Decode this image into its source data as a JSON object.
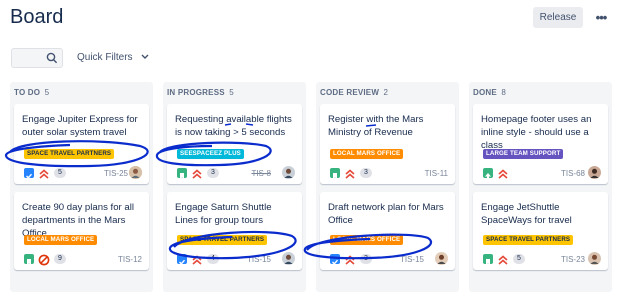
{
  "page": {
    "title": "Board"
  },
  "toolbar": {
    "release_label": "Release",
    "more_label": "•••"
  },
  "filters": {
    "search_value": "",
    "quick_filters_label": "Quick Filters"
  },
  "colors": {
    "column_bg": "#f4f5f7",
    "annotation_ink": "#0b2ccc",
    "story": "#36b37e",
    "task": "#2684ff",
    "label_yellow": "#ffc400",
    "label_orange": "#ff8b00",
    "label_teal": "#00b8d9",
    "label_purple": "#6554c0"
  },
  "columns": [
    {
      "name": "TO DO",
      "count": "5",
      "cards": [
        {
          "title": "Engage Jupiter Express for outer solar system travel",
          "label": "SPACE TRAVEL PARTNERS",
          "label_color": "yellow",
          "type_icon": "task-checkbox-icon",
          "priority_icon": "highest-priority-icon",
          "estimate": "5",
          "key": "TIS-25",
          "avatar": "avatar-woman"
        },
        {
          "title": "Create 90 day plans for all departments in the Mars Office",
          "label": "LOCAL MARS OFFICE",
          "label_color": "orange",
          "type_icon": "story-icon",
          "priority_icon": "blocker-icon",
          "estimate": "9",
          "key": "TIS-12",
          "avatar": ""
        }
      ]
    },
    {
      "name": "IN PROGRESS",
      "count": "5",
      "cards": [
        {
          "title": "Requesting available flights is now taking > 5 seconds",
          "label": "SEESPACEEZ PLUS",
          "label_color": "teal",
          "type_icon": "story-icon",
          "priority_icon": "highest-priority-icon",
          "estimate": "3",
          "key": "TIS-8",
          "avatar": "avatar-man"
        },
        {
          "title": "Engage Saturn Shuttle Lines for group tours",
          "label": "SPACE TRAVEL PARTNERS",
          "label_color": "yellow",
          "type_icon": "task-checkbox-icon",
          "priority_icon": "highest-priority-icon",
          "estimate": "4",
          "key": "TIS-15",
          "avatar": "avatar-man"
        }
      ]
    },
    {
      "name": "CODE REVIEW",
      "count": "2",
      "cards": [
        {
          "title": "Register with the Mars Ministry of Revenue",
          "label": "LOCAL MARS OFFICE",
          "label_color": "orange",
          "type_icon": "story-icon",
          "priority_icon": "highest-priority-icon",
          "estimate": "3",
          "key": "TIS-11",
          "avatar": ""
        },
        {
          "title": "Draft network plan for Mars Office",
          "label": "LOCAL MARS OFFICE",
          "label_color": "orange",
          "type_icon": "task-checkbox-icon",
          "priority_icon": "highest-priority-icon",
          "estimate": "3",
          "key": "TIS-15",
          "avatar": "avatar-woman"
        }
      ]
    },
    {
      "name": "DONE",
      "count": "8",
      "cards": [
        {
          "title": "Homepage footer uses an inline style - should use a class",
          "label": "LARGE TEAM SUPPORT",
          "label_color": "purple",
          "type_icon": "bug-up-icon",
          "priority_icon": "highest-priority-icon",
          "estimate": "",
          "key": "TIS-68",
          "avatar": "avatar-woman"
        },
        {
          "title": "Engage JetShuttle SpaceWays for travel",
          "label": "SPACE TRAVEL PARTNERS",
          "label_color": "yellow",
          "type_icon": "story-icon",
          "priority_icon": "highest-priority-icon",
          "estimate": "5",
          "key": "TIS-23",
          "avatar": "avatar-woman"
        }
      ]
    }
  ]
}
